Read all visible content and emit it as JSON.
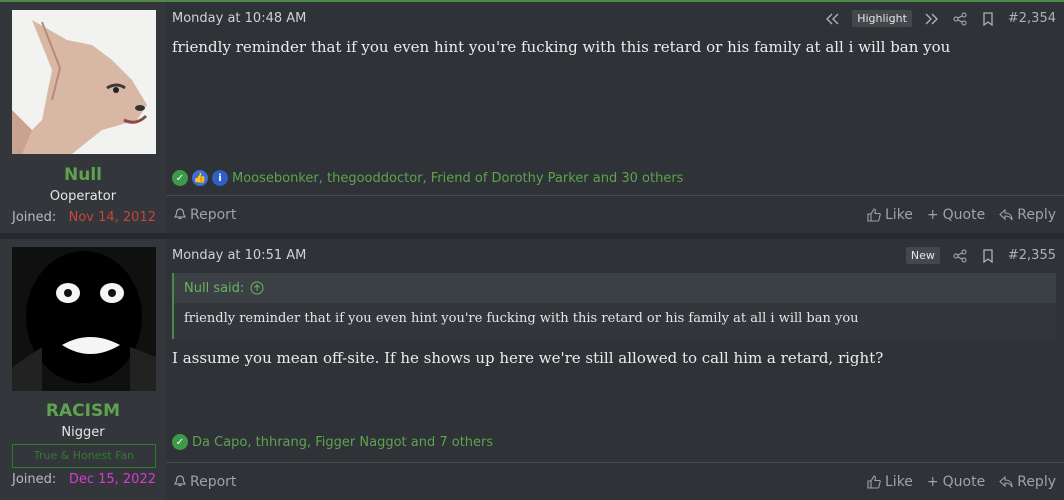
{
  "posts": [
    {
      "user": {
        "name": "Null",
        "title": "Ooperator",
        "joined_label": "Joined:",
        "joined_date": "Nov 14, 2012"
      },
      "time": "Monday at 10:48 AM",
      "highlight_label": "Highlight",
      "number": "#2,354",
      "message": "friendly reminder that if you even hint you're fucking with this retard or his family at all i will ban you",
      "reactions_text": "Moosebonker, thegooddoctor, Friend of Dorothy Parker and 30 others",
      "report_label": "Report",
      "like_label": "Like",
      "quote_label": "Quote",
      "reply_label": "Reply"
    },
    {
      "user": {
        "name": "RACISM",
        "title": "Nigger",
        "banner": "True & Honest Fan",
        "joined_label": "Joined:",
        "joined_date": "Dec 15, 2022"
      },
      "time": "Monday at 10:51 AM",
      "new_label": "New",
      "number": "#2,355",
      "quote_author": "Null said:",
      "quote_text": "friendly reminder that if you even hint you're fucking with this retard or his family at all i will ban you",
      "message": "I assume you mean off-site. If he shows up here we're still allowed to call him a retard, right?",
      "reactions_text": "Da Capo, thhrang, Figger Naggot and 7 others",
      "report_label": "Report",
      "like_label": "Like",
      "quote_label": "Quote",
      "reply_label": "Reply"
    }
  ],
  "colors": {
    "accent": "#5ea34f",
    "joined1": "#c8463a",
    "joined2": "#d83ccd"
  }
}
